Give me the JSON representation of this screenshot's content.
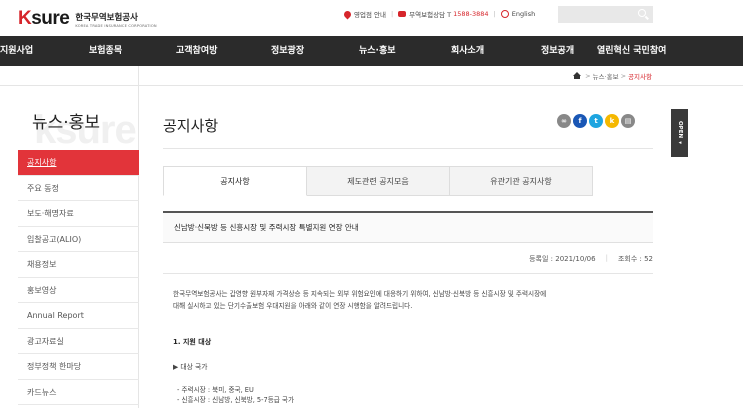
{
  "header": {
    "logo_mark_k": "K",
    "logo_mark_sure": "sure",
    "logo_kr": "한국무역보험공사",
    "logo_en": "KOREA TRADE INSURANCE CORPORATION",
    "utils": [
      {
        "icon": "pin-icon",
        "label": "영업점 안내"
      },
      {
        "icon": "phone-icon",
        "label": "무역보험상담 T",
        "number": "1588-3884"
      },
      {
        "icon": "globe-icon",
        "label": "English"
      }
    ],
    "search_placeholder": ""
  },
  "nav": {
    "items": [
      "지원사업",
      "보험종목",
      "고객참여방",
      "정보광장",
      "뉴스·홍보",
      "회사소개",
      "정보공개",
      "열린혁신 국민참여"
    ]
  },
  "breadcrumb": {
    "items": [
      "뉴스·홍보",
      "공지사항"
    ]
  },
  "sidebar": {
    "watermark": "ksure",
    "title": "뉴스·홍보",
    "items": [
      "공지사항",
      "주요 동정",
      "보도·해명자료",
      "입찰공고(ALIO)",
      "채용정보",
      "홍보영상",
      "Annual Report",
      "광고자료실",
      "정부정책 한마당",
      "카드뉴스"
    ]
  },
  "content": {
    "page_title": "공지사항",
    "share_icons": [
      "link-icon",
      "facebook-icon",
      "twitter-icon",
      "kakaostory-icon",
      "print-icon"
    ],
    "open_label": "OPEN ◂",
    "tabs": [
      "공지사항",
      "제도관련 공지모음",
      "유관기관 공지사항"
    ],
    "article": {
      "title": "신남방·신북방 등 신흥시장 및 주력시장 특별지원 연장 안내",
      "date_label": "등록일 : 2021/10/06",
      "views_label": "조회수 : 52",
      "body_line1": "한국무역보험공사는 갑영향 원부자재 가격상승 등 지속되는 외부 위험요인에 대응하기 위하여, 신남방·신북방 등 신흥시장 및 주력시장에",
      "body_line2": "대해 실시하고 있는 단기수출보험 우대지원을 아래와 같이 연장 시행함을 알려드립니다.",
      "section1": "1. 지원 대상",
      "target_label": "▶ 대상 국가",
      "list1": "- 주력시장 : 북미, 중국, EU",
      "list2": "- 신흥시장 : 신남방, 신북방, 5-7등급 국가"
    }
  },
  "colors": {
    "accent": "#d6252b",
    "nav_bg": "#2b2b2b",
    "sidebar_active": "#e2343a"
  }
}
